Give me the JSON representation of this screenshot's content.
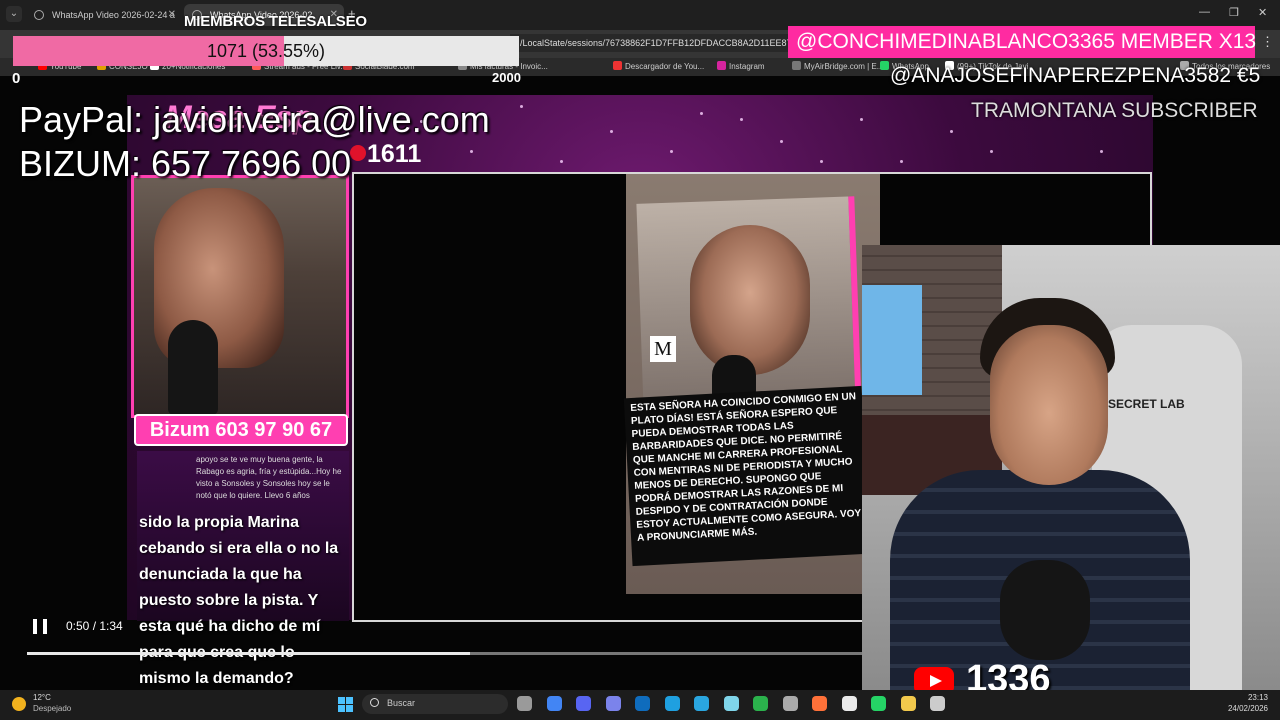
{
  "browser": {
    "tabs": [
      {
        "label": "WhatsApp Video 2026-02-24 a",
        "active": false
      },
      {
        "label": "WhatsApp Video 2026-02",
        "active": true
      }
    ],
    "url": "/LocalState/sessions/76738862F1D7FFB12DFDACCB8A2D11EE87F",
    "bookmarks": [
      {
        "label": "YouTube",
        "color": "#ff0000"
      },
      {
        "label": "CONSEJO",
        "color": "#e0a000"
      },
      {
        "label": "20+Notificaciones",
        "color": "#ffffff"
      },
      {
        "label": "Stream ads - Free Liv...",
        "color": "#ff5a5a"
      },
      {
        "label": "SocialBlade.com",
        "color": "#c33"
      },
      {
        "label": "Mis facturas - Invoic...",
        "color": "#888"
      },
      {
        "label": "Descargador de You...",
        "color": "#e33"
      },
      {
        "label": "Instagram",
        "color": "#d6249f"
      },
      {
        "label": "MyAirBridge.com | E...",
        "color": "#777"
      },
      {
        "label": "WhatsApp",
        "color": "#25d366"
      },
      {
        "label": "(99+) TikTok de Javi",
        "color": "#ffffff"
      },
      {
        "label": "Todos los marcadores",
        "color": "#aaa"
      }
    ]
  },
  "members": {
    "title": "MIEMBROS TELESALSEO",
    "progress_text": "1071 (53.55%)",
    "progress_fraction": 0.5355,
    "fill_color": "#f06aa4",
    "min_label": "0",
    "goal_label": "2000"
  },
  "alerts": {
    "member_banner": "@CONCHIMEDINABLANCO3365  MEMBER X13",
    "banner_color": "#ff2ba1",
    "donation": "@ANAJOSEFINAPEREZPENA3582  €5",
    "subscriber": "TRAMONTANA  SUBSCRIBER"
  },
  "donate": {
    "paypal": "PayPal: javioliveira@live.com",
    "bizum": "BIZUM: 657 7696 00"
  },
  "video": {
    "show_logo": "Mesa Esp",
    "episode_number": "1611",
    "left_bizum": "Bizum 603 97 90 67",
    "comment_text": "apoyo se te ve muy buena gente, la Rabago es agria, fría y estúpida...Hoy he visto a Sonsoles y Sonsoles hoy se le notó que lo quiere. Llevo 6 años",
    "badge": "M",
    "statement": "ESTA SEÑORA HA COINCIDO CONMIGO EN UN PLATO DÍAS! ESTÁ SEÑORA ESPERO QUE PUEDA DEMOSTRAR TODAS LAS BARBARIDADES QUE DICE. NO PERMITIRÉ QUE MANCHE MI CARRERA PROFESIONAL CON MENTIRAS NI DE PERIODISTA Y MUCHO MENOS DE DERECHO. SUPONGO QUE PODRÁ DEMOSTRAR LAS RAZONES DE MI DESPIDO Y DE CONTRATACIÓN DONDE ESTOY ACTUALMENTE COMO ASEGURA. VOY A PRONUNCIARME MÁS.",
    "caption": "sido la propia Marina cebando si era ella o no la denunciada la que ha puesto sobre la pista. Y esta qué ha dicho de mí para que crea que lo mismo la demando?"
  },
  "player": {
    "time": "0:50 / 1:34",
    "progress_fraction": 0.53
  },
  "webcam": {
    "chair_brand": "SECRET LAB",
    "youtube_viewers": "1336"
  },
  "taskbar": {
    "weather_temp": "12°C",
    "weather_desc": "Despejado",
    "search_placeholder": "Buscar",
    "time": "23:13",
    "date": "24/02/2026",
    "icons": [
      "file-explorer-icon",
      "chrome-icon",
      "discord-icon",
      "teams-icon",
      "outlook-icon",
      "edge-icon",
      "telegram-icon",
      "app-icon",
      "camtasia-icon",
      "settings-icon",
      "firefox-icon",
      "chrome-alt-icon",
      "whatsapp-icon",
      "folder-icon",
      "app2-icon"
    ]
  }
}
